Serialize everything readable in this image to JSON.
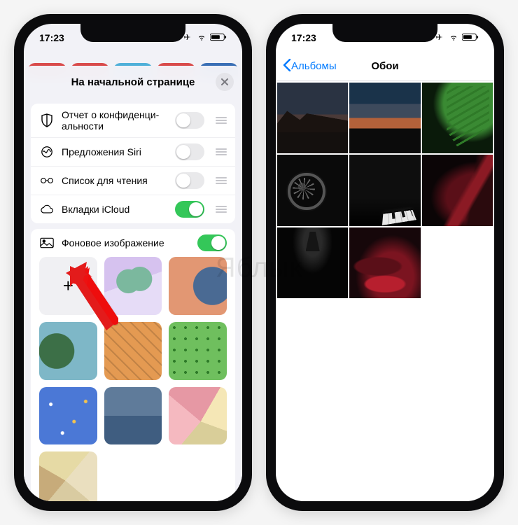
{
  "watermark": "Яблык",
  "status": {
    "time": "17:23"
  },
  "left": {
    "sheet_title": "На начальной странице",
    "rows": {
      "privacy": "Отчет о конфиденци­альности",
      "siri": "Предложения Siri",
      "reading": "Список для чтения",
      "icloud_tabs": "Вкладки iCloud"
    },
    "toggles": {
      "privacy": false,
      "siri": false,
      "reading": false,
      "icloud_tabs": true,
      "background": true
    },
    "background_label": "Фоновое изображение",
    "add_symbol": "+"
  },
  "right": {
    "back_label": "Альбомы",
    "title": "Обои"
  }
}
